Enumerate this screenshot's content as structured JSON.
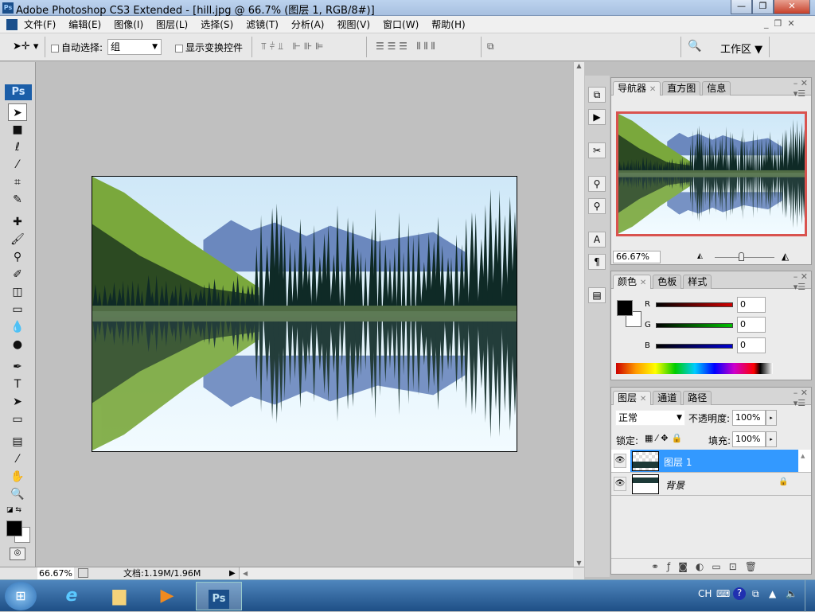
{
  "title": "Adobe Photoshop CS3 Extended - [hill.jpg @ 66.7% (图层 1, RGB/8#)]",
  "app_icon": "Ps",
  "menu": [
    "文件(F)",
    "编辑(E)",
    "图像(I)",
    "图层(L)",
    "选择(S)",
    "滤镜(T)",
    "分析(A)",
    "视图(V)",
    "窗口(W)",
    "帮助(H)"
  ],
  "options": {
    "auto_select_label": "自动选择:",
    "auto_select_value": "组",
    "show_transform_label": "显示变换控件",
    "workspace_label": "工作区 ▼"
  },
  "toolbox": {
    "logo": "Ps"
  },
  "status": {
    "zoom": "66.67%",
    "doc_info": "文档:1.19M/1.96M"
  },
  "navigator": {
    "tabs": [
      "导航器",
      "直方图",
      "信息"
    ],
    "zoom": "66.67%",
    "zoom_slider": 0.5
  },
  "color": {
    "tabs": [
      "颜色",
      "色板",
      "样式"
    ],
    "channels": [
      {
        "label": "R",
        "value": "0",
        "color": "#c00000"
      },
      {
        "label": "G",
        "value": "0",
        "color": "#00b000"
      },
      {
        "label": "B",
        "value": "0",
        "color": "#0000c0"
      }
    ]
  },
  "layers": {
    "tabs": [
      "图层",
      "通道",
      "路径"
    ],
    "blend_mode": "正常",
    "opacity_label": "不透明度:",
    "opacity": "100%",
    "lock_label": "锁定:",
    "fill_label": "填充:",
    "fill": "100%",
    "items": [
      {
        "name": "图层 1",
        "selected": true
      },
      {
        "name": "背景",
        "locked": true
      }
    ]
  },
  "taskbar": {
    "tray_lang": "CH"
  },
  "colors": {
    "selection": "#3399ff",
    "nav_frame": "#d9534f"
  }
}
